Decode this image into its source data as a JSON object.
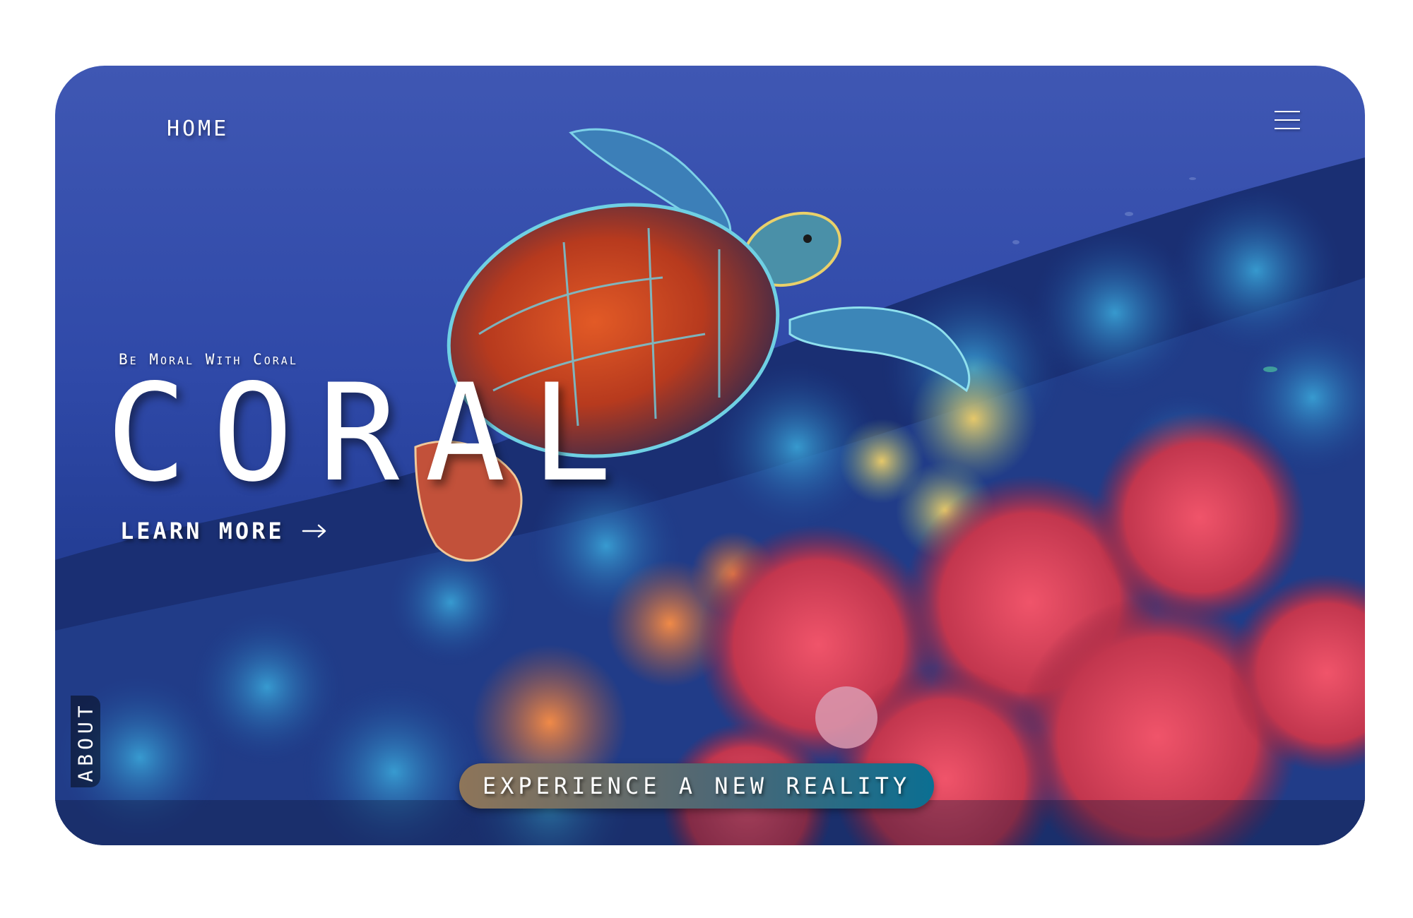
{
  "nav": {
    "home_label": "HOME"
  },
  "menu": {
    "icon": "hamburger-menu-icon"
  },
  "hero": {
    "tagline": "Be Moral With Coral",
    "headline": "CORAL",
    "learn_more_label": "LEARN MORE",
    "learn_more_icon": "arrow-right-icon"
  },
  "side_tab": {
    "about_label": "ABOUT"
  },
  "cta": {
    "label": "EXPERIENCE A NEW REALITY"
  },
  "background": {
    "image": "sea-turtle-over-coral-reef",
    "colors": {
      "ocean": "#2f49a8",
      "coral_red": "#d9414a",
      "coral_pink": "#e47a8a",
      "coral_orange": "#e07a3c"
    }
  },
  "colors": {
    "text": "#ffffff",
    "cta_start": "#8e7559",
    "cta_end": "#0b6f92",
    "page": "#ffffff"
  }
}
